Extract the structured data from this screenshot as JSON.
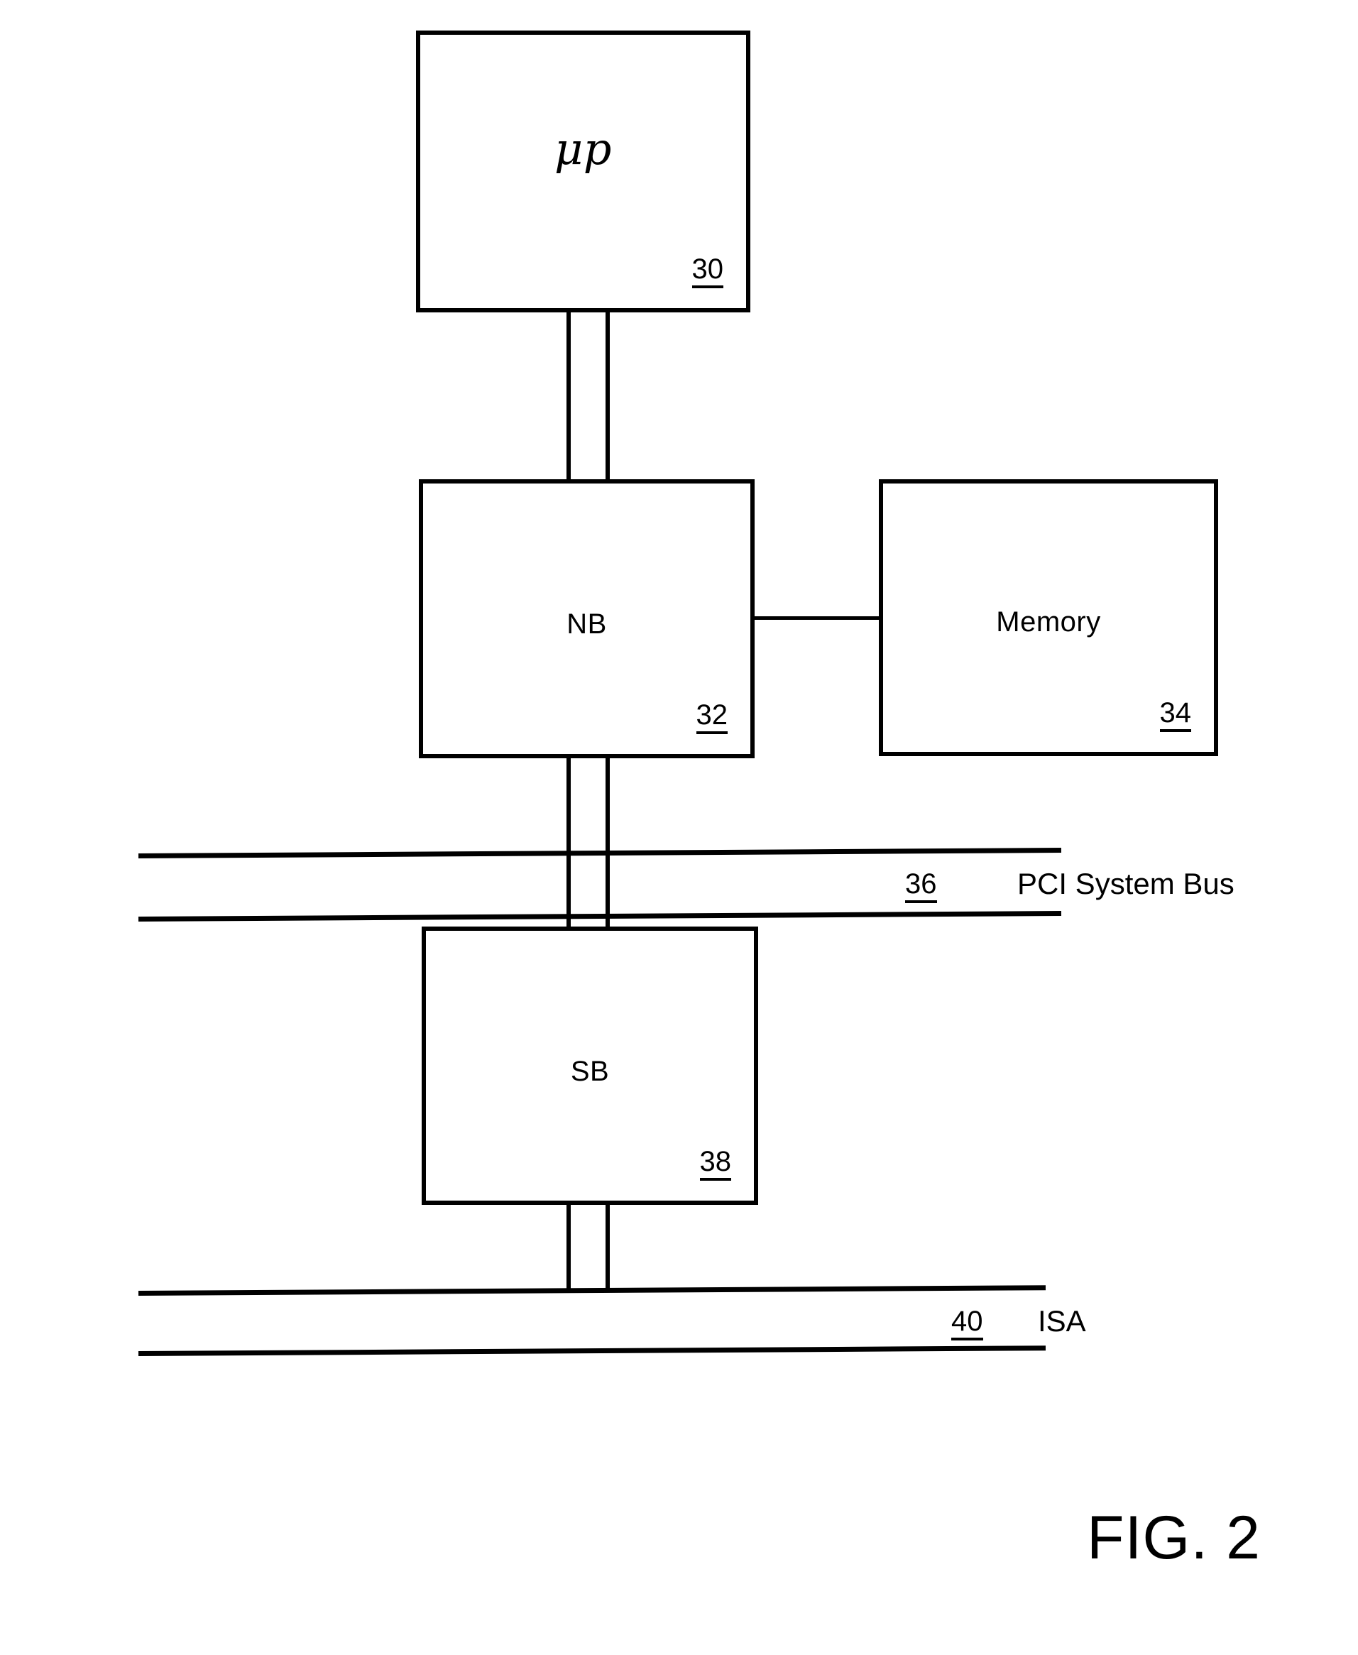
{
  "figure": {
    "caption": "FIG. 2",
    "blocks": [
      {
        "key": "mp",
        "label": "μp",
        "ref": "30"
      },
      {
        "key": "nb",
        "label": "NB",
        "ref": "32"
      },
      {
        "key": "memory",
        "label": "Memory",
        "ref": "34"
      },
      {
        "key": "sb",
        "label": "SB",
        "ref": "38"
      }
    ],
    "buses": [
      {
        "key": "pci",
        "label": "PCI System Bus",
        "ref": "36"
      },
      {
        "key": "isa",
        "label": "ISA",
        "ref": "40"
      }
    ]
  }
}
